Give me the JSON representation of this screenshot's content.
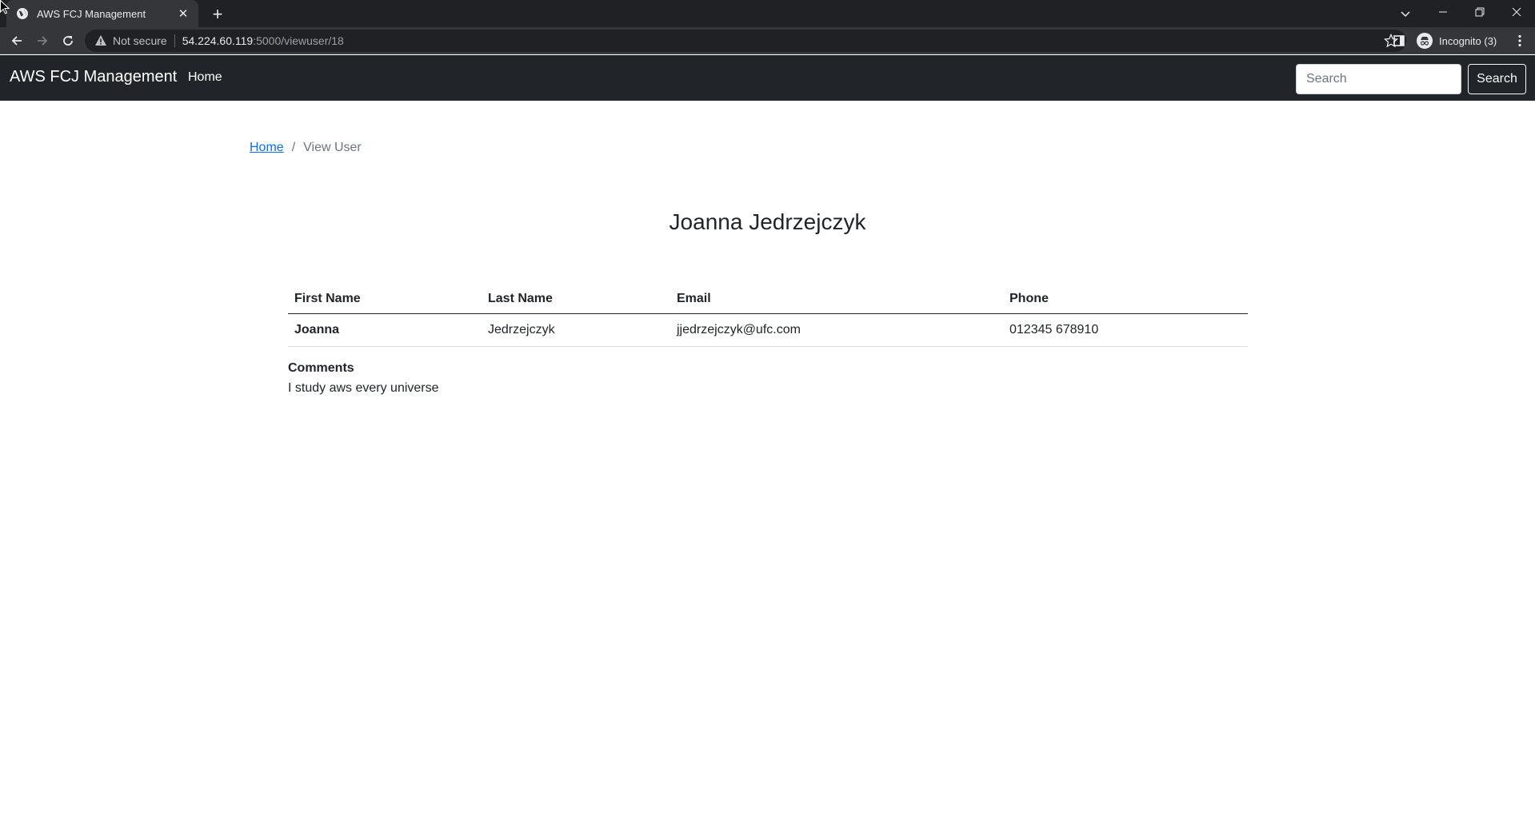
{
  "browser": {
    "tab_title": "AWS FCJ Management",
    "security_label": "Not secure",
    "url_host": "54.224.60.119",
    "url_path": ":5000/viewuser/18",
    "profile_label": "Incognito (3)"
  },
  "navbar": {
    "brand": "AWS FCJ Management",
    "home_link": "Home",
    "search_placeholder": "Search",
    "search_button": "Search"
  },
  "breadcrumb": {
    "home": "Home",
    "separator": "/",
    "current": "View User"
  },
  "page": {
    "title": "Joanna Jedrzejczyk"
  },
  "table": {
    "headers": [
      "First Name",
      "Last Name",
      "Email",
      "Phone"
    ],
    "row": {
      "first_name": "Joanna",
      "last_name": "Jedrzejczyk",
      "email": "jjedrzejczyk@ufc.com",
      "phone": "012345 678910"
    }
  },
  "comments": {
    "label": "Comments",
    "text": "I study aws every universe"
  },
  "colors": {
    "navbar_bg": "#212529",
    "link": "#0d6efd",
    "browser_tabbar": "#202124",
    "browser_toolbar": "#35363a"
  }
}
